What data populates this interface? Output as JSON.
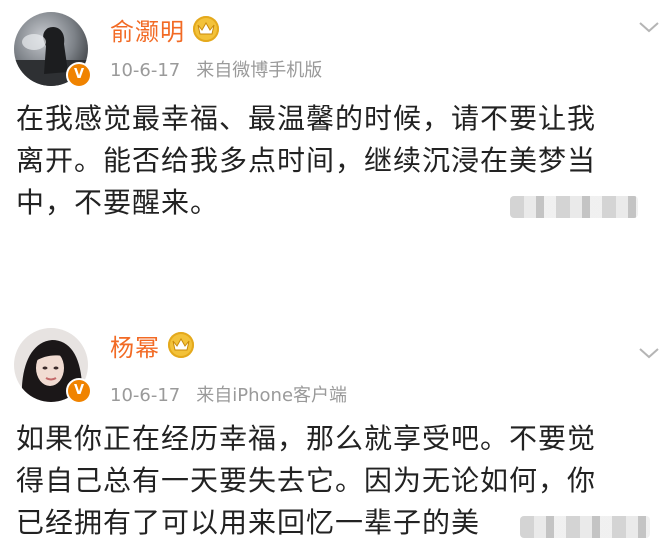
{
  "posts": [
    {
      "username": "俞灏明",
      "verified_badge": "V",
      "date": "10-6-17",
      "source": "来自微博手机版",
      "lines": [
        "在我感觉最幸福、最温馨的时候，请不要让我",
        "离开。能否给我多点时间，继续沉浸在美梦当",
        "中，不要醒来。"
      ],
      "avatar_icon": "avatar-photo-icon",
      "crown_icon": "vip-crown-icon",
      "menu_icon": "chevron-down-icon"
    },
    {
      "username": "杨幂",
      "verified_badge": "V",
      "date": "10-6-17",
      "source": "来自iPhone客户端",
      "lines": [
        "如果你正在经历幸福，那么就享受吧。不要觉",
        "得自己总有一天要失去它。因为无论如何，你",
        "已经拥有了可以用来回忆一辈子的美"
      ],
      "avatar_icon": "avatar-photo-icon",
      "crown_icon": "vip-crown-icon",
      "menu_icon": "chevron-down-icon"
    }
  ],
  "colors": {
    "username": "#f26a24",
    "meta": "#9a9a9a",
    "text": "#222222",
    "badge": "#f08300",
    "crown": "#f3c23a"
  }
}
